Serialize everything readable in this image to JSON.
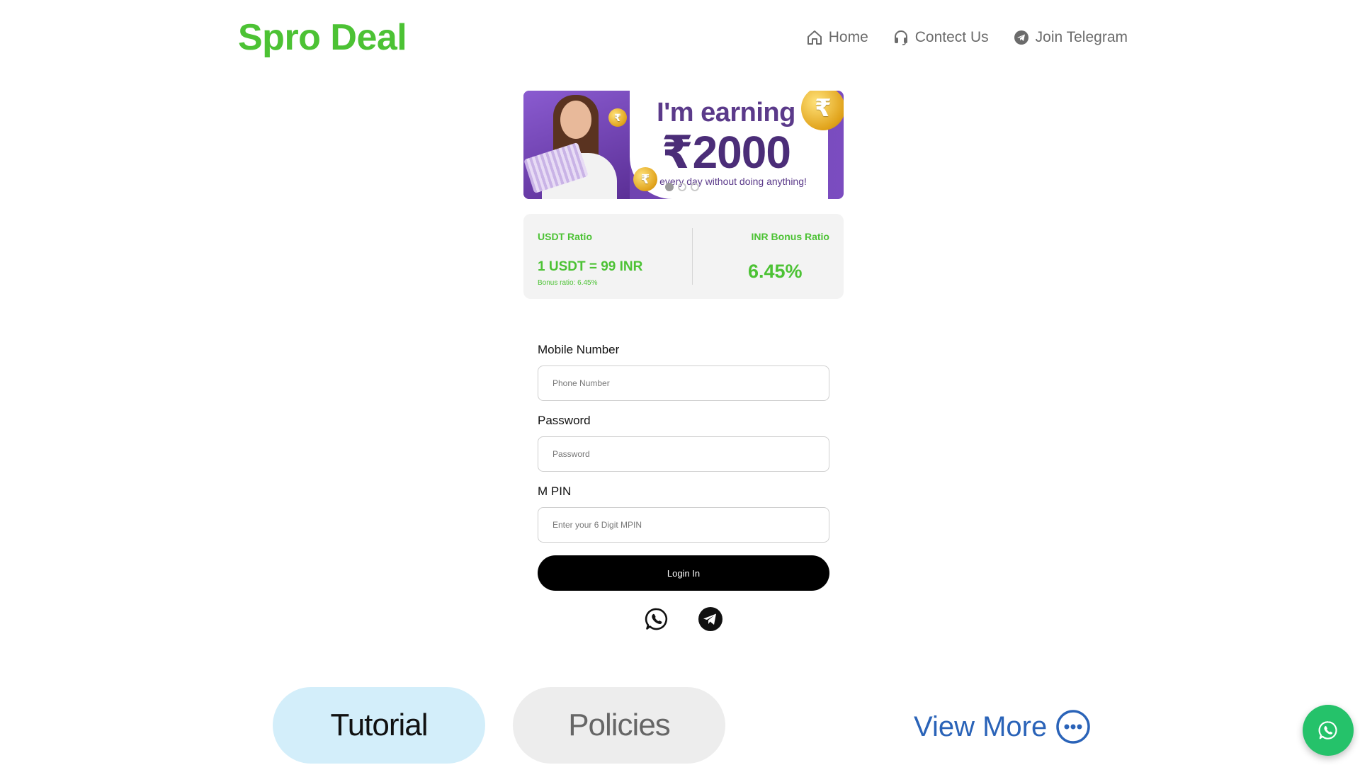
{
  "header": {
    "brand": "Spro Deal",
    "nav": [
      {
        "label": "Home",
        "icon": "home-icon"
      },
      {
        "label": "Contect Us",
        "icon": "headset-icon"
      },
      {
        "label": "Join Telegram",
        "icon": "telegram-icon"
      }
    ]
  },
  "banner": {
    "headline": "I'm earning",
    "amount": "₹2000",
    "subtext": "every day without doing anything!",
    "coin_symbol": "₹",
    "slide_count": 3,
    "active_slide": 0
  },
  "ratio": {
    "usdt_label": "USDT Ratio",
    "usdt_value": "1 USDT = 99 INR",
    "bonus_note": "Bonus ratio: 6.45%",
    "inr_label": "INR Bonus Ratio",
    "inr_value": "6.45%"
  },
  "form": {
    "mobile_label": "Mobile Number",
    "mobile_placeholder": "Phone Number",
    "password_label": "Password",
    "password_placeholder": "Password",
    "mpin_label": "M PIN",
    "mpin_placeholder": "Enter your 6 Digit MPIN",
    "login_label": "Login In"
  },
  "social": [
    "whatsapp-icon",
    "telegram-icon"
  ],
  "bottom": {
    "tutorial": "Tutorial",
    "policies": "Policies",
    "view_more": "View More"
  },
  "colors": {
    "brand_green": "#4cc234",
    "login_black": "#000000",
    "tutorial_bg": "#d3eefa",
    "policies_bg": "#ededed",
    "view_more_blue": "#2a63b8",
    "whatsapp_green": "#25c26a",
    "banner_purple": "#6a3fa8"
  }
}
